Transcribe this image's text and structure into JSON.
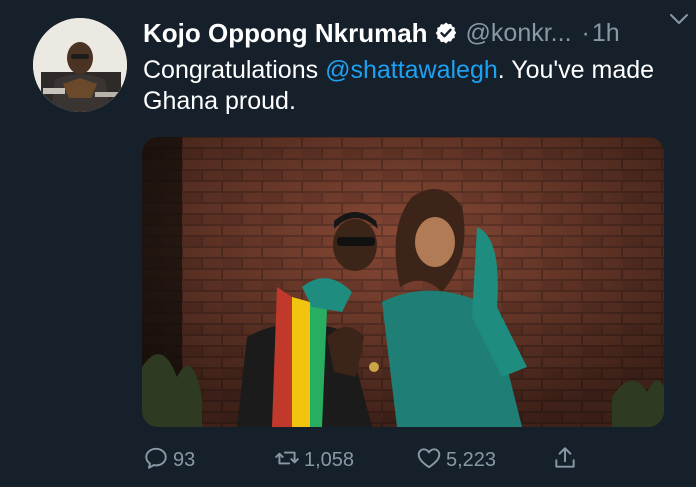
{
  "tweet": {
    "author_name": "Kojo Oppong Nkrumah",
    "handle": "@konkr...",
    "separator": "·",
    "time": "1h",
    "text_before": "Congratulations ",
    "mention": "@shattawalegh",
    "text_after": ". You've made Ghana proud."
  },
  "actions": {
    "reply_count": "93",
    "retweet_count": "1,058",
    "like_count": "5,223"
  },
  "icons": {
    "verified": "verified-badge-icon",
    "menu": "chevron-down-icon",
    "reply": "reply-icon",
    "retweet": "retweet-icon",
    "like": "heart-icon",
    "share": "share-icon"
  },
  "colors": {
    "background": "#15202b",
    "text": "#ffffff",
    "secondary": "#8899a6",
    "accent": "#1da1f2"
  }
}
